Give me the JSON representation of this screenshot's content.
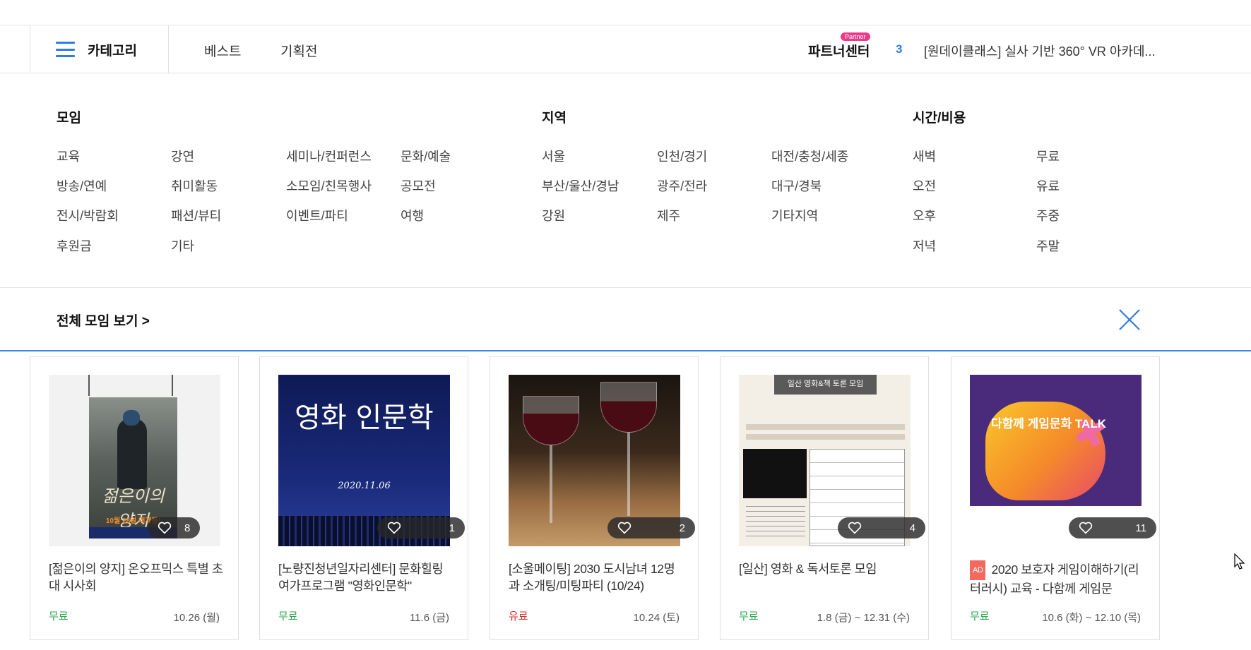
{
  "nav": {
    "category_label": "카테고리",
    "links": [
      "베스트",
      "기획전"
    ],
    "partner_label": "파트너센터",
    "partner_badge": "Partner",
    "rank_number": "3",
    "rank_text": "[원데이클래스] 실사 기반 360° VR 아카데..."
  },
  "menu": {
    "moim": {
      "title": "모임",
      "items": [
        "교육",
        "강연",
        "세미나/컨퍼런스",
        "문화/예술",
        "방송/연예",
        "취미활동",
        "소모임/친목행사",
        "공모전",
        "전시/박람회",
        "패션/뷰티",
        "이벤트/파티",
        "여행",
        "후원금",
        "기타"
      ]
    },
    "region": {
      "title": "지역",
      "items": [
        "서울",
        "인천/경기",
        "대전/충청/세종",
        "부산/울산/경남",
        "광주/전라",
        "대구/경북",
        "강원",
        "제주",
        "기타지역"
      ]
    },
    "time": {
      "title": "시간/비용",
      "items": [
        "새벽",
        "무료",
        "오전",
        "유료",
        "오후",
        "주중",
        "저녁",
        "주말"
      ]
    }
  },
  "view_all": "전체 모임 보기  >",
  "cards": [
    {
      "title": "[젊은이의 양지] 온오프믹스 특별 초대 시사회",
      "likes": "8",
      "price": "무료",
      "date": "10.26 (월)",
      "ad": "",
      "img_text": "10월 28일 대개봉!"
    },
    {
      "title": "[노량진청년일자리센터] 문화힐링 여가프로그램 \"영화인문학\"",
      "likes": "1",
      "price": "무료",
      "date": "11.6 (금)",
      "ad": "",
      "img_text": "영화 인문학"
    },
    {
      "title": "[소울메이팅] 2030 도시남녀 12명과 소개팅/미팅파티 (10/24)",
      "likes": "2",
      "price": "유료",
      "date": "10.24 (토)",
      "ad": "",
      "img_text": ""
    },
    {
      "title": "[일산] 영화 & 독서토론 모임",
      "likes": "4",
      "price": "무료",
      "date": "1.8 (금) ~ 12.31 (수)",
      "ad": "",
      "img_text": "일산 영화&책 토론 모임"
    },
    {
      "title": "2020 보호자 게임이해하기(리터러시) 교육 - 다함께 게임문",
      "likes": "11",
      "price": "무료",
      "date": "10.6 (화) ~ 12.10 (목)",
      "ad": "AD",
      "img_text": "다함께 게임문화 TALK"
    }
  ],
  "colors": {
    "accent": "#2f7be8",
    "free": "#2aa84a",
    "paid": "#e02b2b",
    "badge": "#ea3a8a"
  }
}
